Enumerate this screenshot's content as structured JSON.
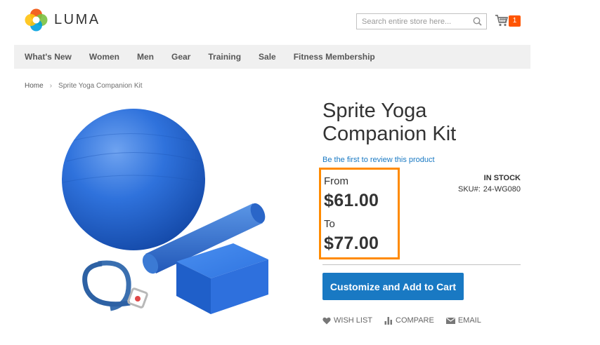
{
  "brand": {
    "name": "LUMA"
  },
  "search": {
    "placeholder": "Search entire store here..."
  },
  "cart": {
    "count": "1"
  },
  "nav": {
    "items": [
      {
        "label": "What's New"
      },
      {
        "label": "Women"
      },
      {
        "label": "Men"
      },
      {
        "label": "Gear"
      },
      {
        "label": "Training"
      },
      {
        "label": "Sale"
      },
      {
        "label": "Fitness Membership"
      }
    ]
  },
  "breadcrumb": {
    "home": "Home",
    "current": "Sprite Yoga Companion Kit"
  },
  "product": {
    "title": "Sprite Yoga Companion Kit",
    "review_link": "Be the first to review this product",
    "price_from_label": "From",
    "price_from": "$61.00",
    "price_to_label": "To",
    "price_to": "$77.00",
    "stock": "IN STOCK",
    "sku_label": "SKU#:",
    "sku": "24-WG080",
    "cta": "Customize and Add to Cart"
  },
  "actions": {
    "wishlist": "Wish List",
    "compare": "Compare",
    "email": "Email"
  },
  "colors": {
    "accent": "#1979c3",
    "cart_badge": "#ff5501",
    "highlight_border": "#ff8a00",
    "nav_background": "#f0f0f0",
    "product_blue": "#2e6fd6"
  },
  "icons": [
    "luma-logo-icon",
    "search-icon",
    "cart-icon",
    "heart-icon",
    "compare-icon",
    "envelope-icon"
  ]
}
